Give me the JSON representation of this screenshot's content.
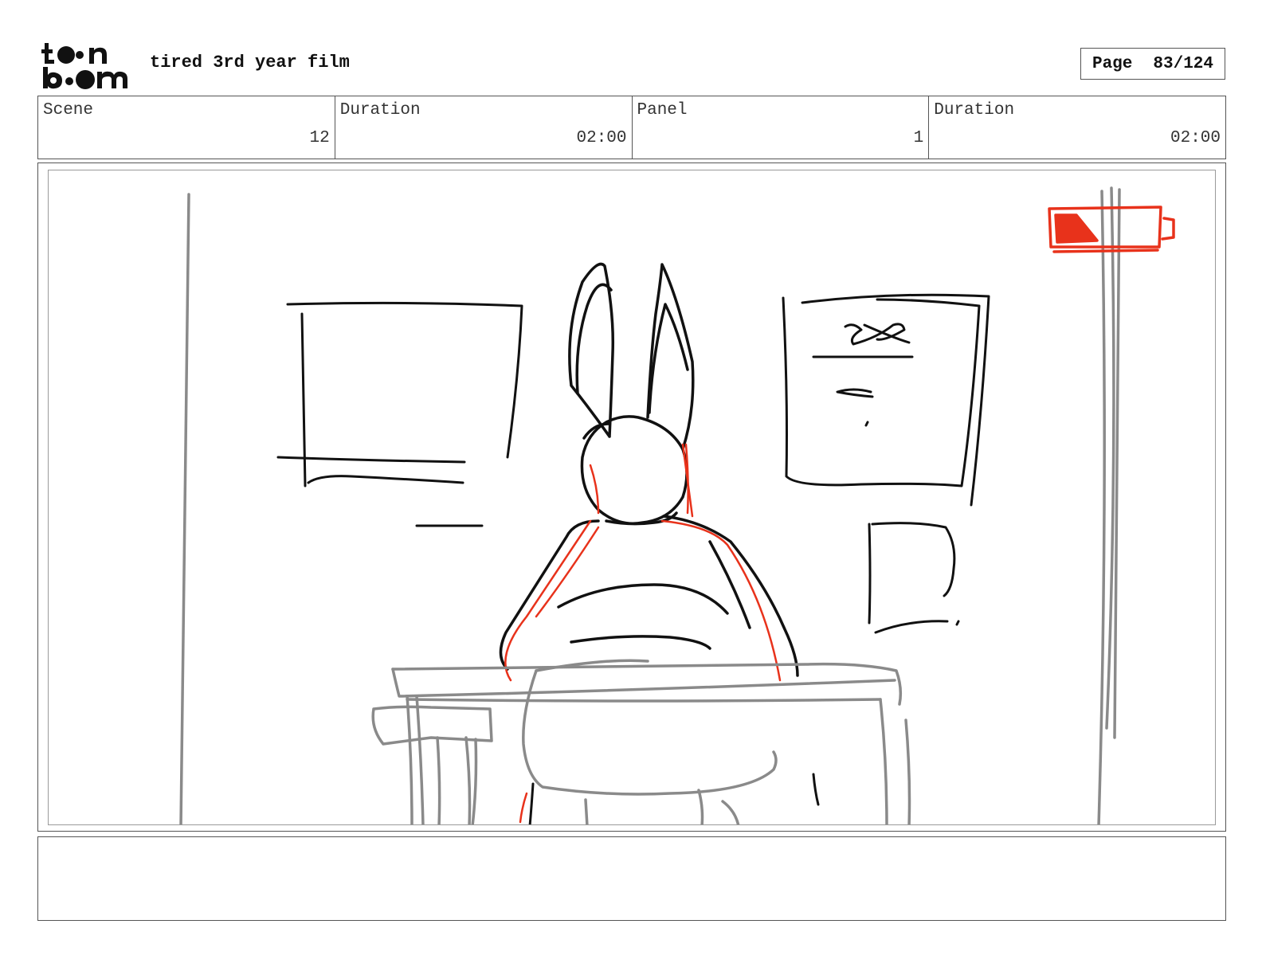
{
  "header": {
    "logo_text": "toon boom",
    "project_title": "tired 3rd year film",
    "page_label": "Page",
    "page_number": "83/124"
  },
  "info": {
    "scene_label": "Scene",
    "scene_value": "12",
    "scene_duration_label": "Duration",
    "scene_duration_value": "02:00",
    "panel_label": "Panel",
    "panel_value": "1",
    "panel_duration_label": "Duration",
    "panel_duration_value": "02:00"
  },
  "colors": {
    "sketch_black": "#111111",
    "sketch_gray": "#8a8a8a",
    "sketch_red": "#e8321b"
  }
}
